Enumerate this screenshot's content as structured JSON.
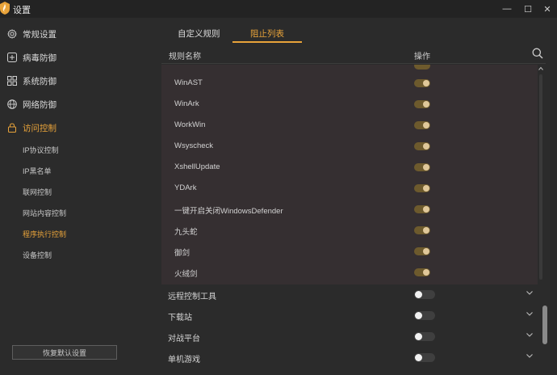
{
  "window": {
    "title": "设置",
    "minimize": "—",
    "maximize": "☐",
    "close": "✕",
    "logo_icon": "shield-logo"
  },
  "sidebar": {
    "items": [
      {
        "label": "常规设置",
        "icon": "gear-icon"
      },
      {
        "label": "病毒防御",
        "icon": "plus-square-icon"
      },
      {
        "label": "系统防御",
        "icon": "grid-icon"
      },
      {
        "label": "网络防御",
        "icon": "globe-icon"
      },
      {
        "label": "访问控制",
        "icon": "lock-icon",
        "active": true
      }
    ],
    "subitems": [
      {
        "label": "IP协议控制"
      },
      {
        "label": "IP黑名单"
      },
      {
        "label": "联网控制"
      },
      {
        "label": "网站内容控制"
      },
      {
        "label": "程序执行控制",
        "active": true
      },
      {
        "label": "设备控制"
      }
    ],
    "reset_label": "恢复默认设置"
  },
  "tabs": [
    {
      "label": "自定义规则"
    },
    {
      "label": "阻止列表",
      "active": true
    }
  ],
  "table": {
    "col_name": "规则名称",
    "col_op": "操作"
  },
  "list": {
    "rows": [
      {
        "label": "WinAST",
        "enabled": true
      },
      {
        "label": "WinArk",
        "enabled": true
      },
      {
        "label": "WorkWin",
        "enabled": true
      },
      {
        "label": "Wsyscheck",
        "enabled": true
      },
      {
        "label": "XshellUpdate",
        "enabled": true
      },
      {
        "label": "YDArk",
        "enabled": true
      },
      {
        "label": "一键开启关闭WindowsDefender",
        "enabled": true
      },
      {
        "label": "九头蛇",
        "enabled": true
      },
      {
        "label": "御剑",
        "enabled": true
      },
      {
        "label": "火绒剑",
        "enabled": true
      }
    ]
  },
  "categories": [
    {
      "label": "远程控制工具",
      "enabled": false
    },
    {
      "label": "下载站",
      "enabled": false
    },
    {
      "label": "对战平台",
      "enabled": false
    },
    {
      "label": "单机游戏",
      "enabled": false
    }
  ],
  "colors": {
    "accent": "#e8a33a",
    "background": "#2b2b2b",
    "list_background": "#352f31"
  }
}
